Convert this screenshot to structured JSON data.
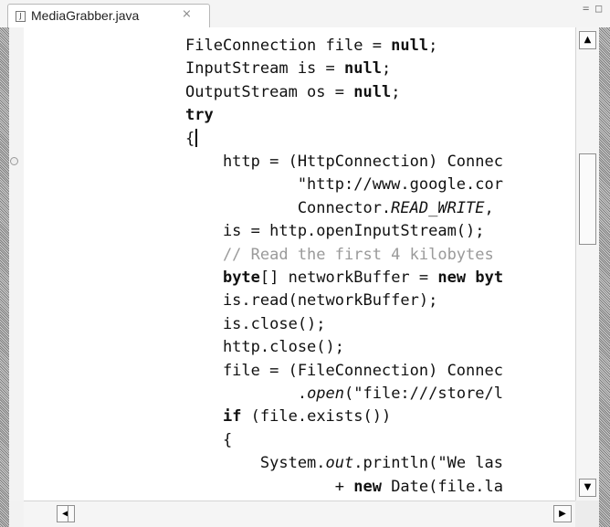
{
  "tab": {
    "title": "MediaGrabber.java",
    "icon": "java-file-icon",
    "close_glyph": "⨯"
  },
  "window_controls": {
    "minimize_glyph": "=",
    "maximize_glyph": "□"
  },
  "scrollbars": {
    "up_glyph": "▲",
    "down_glyph": "▼",
    "left_glyph": "◀",
    "right_glyph": "▶"
  },
  "code_lines": [
    {
      "segments": [
        {
          "t": "FileConnection file = "
        },
        {
          "t": "null",
          "c": "kw"
        },
        {
          "t": ";"
        }
      ]
    },
    {
      "segments": [
        {
          "t": "InputStream is = "
        },
        {
          "t": "null",
          "c": "kw"
        },
        {
          "t": ";"
        }
      ]
    },
    {
      "segments": [
        {
          "t": "OutputStream os = "
        },
        {
          "t": "null",
          "c": "kw"
        },
        {
          "t": ";"
        }
      ]
    },
    {
      "segments": [
        {
          "t": "try",
          "c": "kw"
        }
      ]
    },
    {
      "segments": [
        {
          "t": "{"
        }
      ],
      "caret": true
    },
    {
      "segments": [
        {
          "t": "    http = (HttpConnection) Connec"
        }
      ]
    },
    {
      "segments": [
        {
          "t": "            \"http://www.google.cor"
        }
      ]
    },
    {
      "segments": [
        {
          "t": "            Connector."
        },
        {
          "t": "READ_WRITE",
          "c": "it"
        },
        {
          "t": ","
        }
      ]
    },
    {
      "segments": [
        {
          "t": "    is = http.openInputStream();"
        }
      ]
    },
    {
      "segments": [
        {
          "t": "    // Read the first 4 kilobytes",
          "c": "cm"
        }
      ]
    },
    {
      "segments": [
        {
          "t": "    "
        },
        {
          "t": "byte",
          "c": "kw"
        },
        {
          "t": "[] networkBuffer = "
        },
        {
          "t": "new",
          "c": "kw"
        },
        {
          "t": " "
        },
        {
          "t": "byt",
          "c": "kw"
        }
      ]
    },
    {
      "segments": [
        {
          "t": "    is.read(networkBuffer);"
        }
      ]
    },
    {
      "segments": [
        {
          "t": "    is.close();"
        }
      ]
    },
    {
      "segments": [
        {
          "t": "    http.close();"
        }
      ]
    },
    {
      "segments": [
        {
          "t": "    file = (FileConnection) Connec"
        }
      ]
    },
    {
      "segments": [
        {
          "t": "            ."
        },
        {
          "t": "open",
          "c": "it"
        },
        {
          "t": "(\"file:///store/l"
        }
      ]
    },
    {
      "segments": [
        {
          "t": "    "
        },
        {
          "t": "if",
          "c": "kw"
        },
        {
          "t": " (file.exists())"
        }
      ]
    },
    {
      "segments": [
        {
          "t": "    {"
        }
      ]
    },
    {
      "segments": [
        {
          "t": "        System."
        },
        {
          "t": "out",
          "c": "it"
        },
        {
          "t": ".println(\"We las"
        }
      ]
    },
    {
      "segments": [
        {
          "t": "                + "
        },
        {
          "t": "new",
          "c": "kw"
        },
        {
          "t": " Date(file.la"
        }
      ]
    }
  ]
}
